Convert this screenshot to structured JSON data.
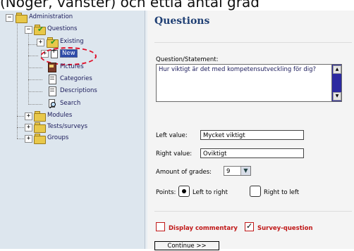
{
  "caption": "(Nöger, vänster) och ettia antai grad",
  "colors": {
    "title": "#1f3f74",
    "tree_selected": "#2c4aa8",
    "accent_red": "#c01818",
    "scrollbar": "#2c2aa0"
  },
  "tree": {
    "administration": {
      "label": "Administration",
      "icon": "folder-icon"
    },
    "questions": {
      "label": "Questions",
      "icon": "folder-check-icon"
    },
    "existing": {
      "label": "Existing",
      "icon": "folder-check-icon"
    },
    "new": {
      "label": "New",
      "icon": "new-item-icon",
      "selected": true
    },
    "pictures": {
      "label": "Pictures",
      "icon": "book-icon"
    },
    "categories": {
      "label": "Categories",
      "icon": "document-icon"
    },
    "descriptions": {
      "label": "Descriptions",
      "icon": "document-icon"
    },
    "search": {
      "label": "Search",
      "icon": "search-icon"
    },
    "modules": {
      "label": "Modules",
      "icon": "folder-icon"
    },
    "tests_surveys": {
      "label": "Tests/surveys",
      "icon": "folder-icon"
    },
    "groups": {
      "label": "Groups",
      "icon": "folder-icon"
    }
  },
  "form": {
    "title": "Questions",
    "question_label": "Question/Statement:",
    "question_value": "Hur viktigt är det med kompetensutveckling för dig?",
    "left_label": "Left value:",
    "left_value": "Mycket viktigt",
    "right_label": "Right value:",
    "right_value": "Oviktigt",
    "grades_label": "Amount of grades:",
    "grades_value": "9",
    "points_label": "Points:",
    "points_left": "Left to right",
    "points_right": "Right to left",
    "points_selected": "Left to right",
    "display_commentary": "Display commentary",
    "display_commentary_checked": false,
    "survey_question": "Survey-question",
    "survey_question_checked": true,
    "continue_button": "Continue >>"
  }
}
